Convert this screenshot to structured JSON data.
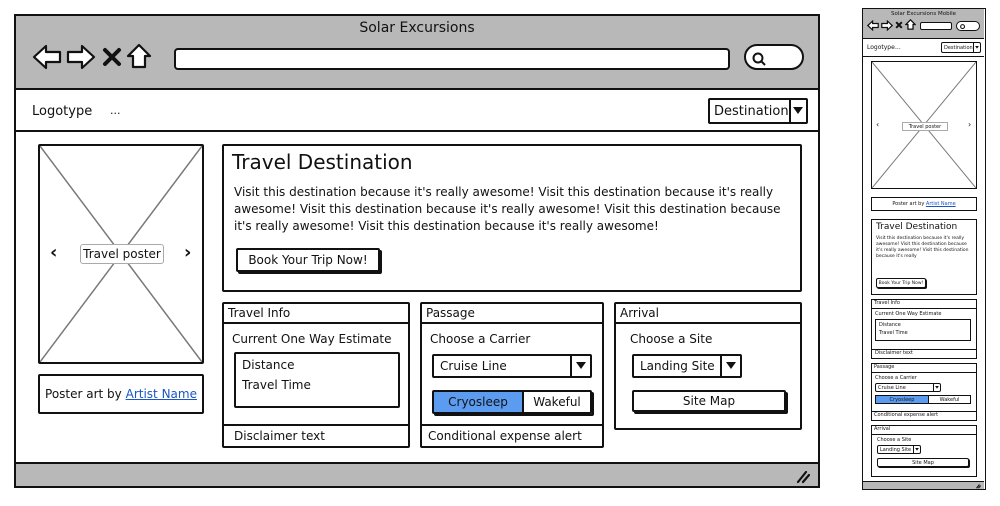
{
  "desktop": {
    "window_title": "Solar Excursions",
    "logotype": "Logotype",
    "logotype_ellipsis": "...",
    "destination_select": "Destination",
    "poster_label": "Travel poster",
    "poster_prev": "‹",
    "poster_next": "›",
    "poster_credit_prefix": "Poster art by",
    "artist_link": "Artist Name",
    "hero_title": "Travel Destination",
    "hero_text": "Visit this destination because it's really awesome! Visit this destination because it's really awesome! Visit this destination because it's really awesome! Visit this destination because it's really awesome! Visit this destination because it's really awesome!",
    "book_button": "Book Your Trip Now!",
    "travel_info": {
      "header": "Travel Info",
      "estimate_title": "Current One Way Estimate",
      "distance": "Distance",
      "travel_time": "Travel Time",
      "disclaimer": "Disclaimer text"
    },
    "passage": {
      "header": "Passage",
      "carrier_label": "Choose a Carrier",
      "carrier_value": "Cruise Line",
      "seg_on": "Cryosleep",
      "seg_off": "Wakeful",
      "alert": "Conditional expense alert"
    },
    "arrival": {
      "header": "Arrival",
      "site_label": "Choose a Site",
      "site_value": "Landing Site",
      "site_map_button": "Site Map"
    }
  },
  "mobile": {
    "window_title": "Solar Excursions Mobile",
    "logotype": "Logotype",
    "logotype_ellipsis": "...",
    "destination_select": "Destination",
    "poster_label": "Travel poster",
    "poster_credit_prefix": "Poster art by",
    "artist_link": "Artist Name",
    "hero_title": "Travel Destination",
    "hero_text": "Visit this destination because it's really awesome! Visit this destination because it's really awesome! Visit this destination because it's really",
    "book_button": "Book Your Trip Now!",
    "travel_info_header": "Travel Info",
    "estimate_title": "Current One Way Estimate",
    "distance": "Distance",
    "travel_time": "Travel Time",
    "disclaimer": "Disclaimer text",
    "passage_header": "Passage",
    "carrier_label": "Choose a Carrier",
    "carrier_value": "Cruise Line",
    "seg_on": "Cryosleep",
    "seg_off": "Wakeful",
    "alert": "Conditional expense alert",
    "arrival_header": "Arrival",
    "site_label": "Choose a Site",
    "site_value": "Landing Site",
    "site_map_button": "Site Map"
  },
  "colors": {
    "chrome_gray": "#b8b8b8",
    "toggle_blue": "#5b9cf0",
    "link_blue": "#1a55c7"
  }
}
